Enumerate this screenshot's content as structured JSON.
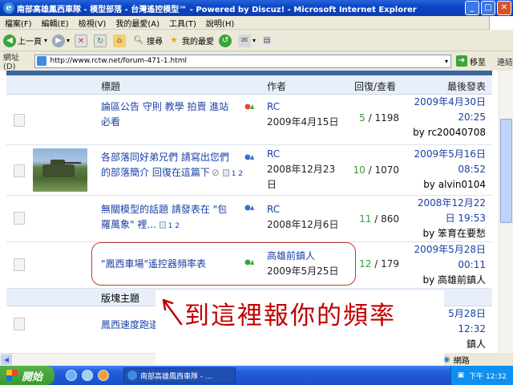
{
  "window": {
    "title": "南部高雄鳳西車隊 - 模型部落 - 台灣遙控模型™ - Powered by Discuz! - Microsoft Internet Explorer"
  },
  "menu": [
    "檔案(F)",
    "編輯(E)",
    "檢視(V)",
    "我的最愛(A)",
    "工具(T)",
    "說明(H)"
  ],
  "toolbar": {
    "back_label": "上一頁",
    "search_label": "搜尋",
    "favorites_label": "我的最愛"
  },
  "address": {
    "label": "網址(D)",
    "url": "http://www.rctw.net/forum-471-1.html",
    "go_label": "移至",
    "links_label": "連結"
  },
  "table_header": {
    "title": "標題",
    "author": "作者",
    "replies_views": "回復/查看",
    "last_post": "最後發表"
  },
  "threads": [
    {
      "title_line1": "論區公告 守則 教學 拍賣 進站",
      "title_line2": "必看",
      "author": "RC",
      "date": "2009年4月15日",
      "replies": "5",
      "views": "/ 1198",
      "last_date_line1": "2009年4月30日",
      "last_date_line2": "20:25",
      "last_by": "by rc20040708"
    },
    {
      "title_line1": "各部落同好弟兄們 請寫出您們",
      "title_line2": "的部落簡介 回復在這篇下",
      "pages": "1 2",
      "author": "RC",
      "date_line1": "2008年12月23",
      "date_line2": "日",
      "replies": "10",
      "views": "/ 1070",
      "last_date_line1": "2009年5月16日",
      "last_date_line2": "08:52",
      "last_by": "by alvin0104"
    },
    {
      "title_line1": "無關模型的話題 請發表在 \"包",
      "title_line2": "羅萬象\" 裡...",
      "pages": "1 2",
      "author": "RC",
      "date": "2008年12月6日",
      "replies": "11",
      "views": "/ 860",
      "last_date_line1": "2008年12月22",
      "last_date_line2": "日 19:53",
      "last_by": "by 笨育在要愁"
    },
    {
      "title_line1": "\"鳳西車場\"遙控器頻率表",
      "author": "高雄前鎮人",
      "date": "2009年5月25日",
      "replies": "12",
      "views": "/ 179",
      "last_date_line1": "2009年5月28日",
      "last_date_line2": "00:11",
      "last_by": "by 高雄前鎮人"
    }
  ],
  "section_label": "版塊主題",
  "partial_thread": {
    "title": "鳳西速度跑道",
    "last_date_line1": "5月28日",
    "last_date_line2": "12:32",
    "last_by": "鎮人"
  },
  "annotation": "到這裡報你的頻率",
  "status": {
    "zone": "網路"
  },
  "taskbar": {
    "start_label": "開始",
    "task_label": "南部高雄鳳西車隊 - ...",
    "clock": "下午 12:32"
  }
}
